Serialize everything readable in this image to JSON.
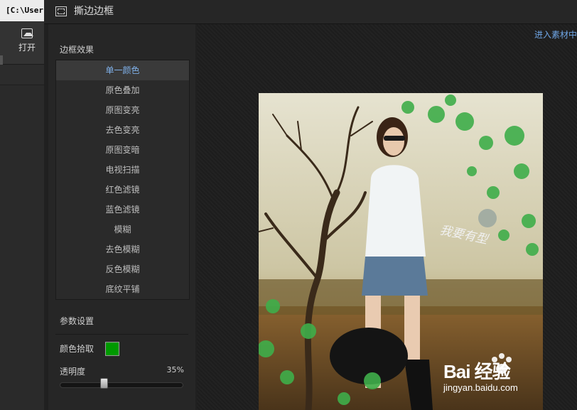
{
  "background_app": {
    "title_fragment": "[C:\\User",
    "open_label": "打开"
  },
  "dialog": {
    "title": "撕边边框",
    "enter_material_link": "进入素材中"
  },
  "border_effects": {
    "section_title": "边框效果",
    "selected_index": 0,
    "items": [
      {
        "label": "单一颜色"
      },
      {
        "label": "原色叠加"
      },
      {
        "label": "原图变亮"
      },
      {
        "label": "去色变亮"
      },
      {
        "label": "原图变暗"
      },
      {
        "label": "电视扫描"
      },
      {
        "label": "红色滤镜"
      },
      {
        "label": "蓝色滤镜"
      },
      {
        "label": "模糊"
      },
      {
        "label": "去色模糊"
      },
      {
        "label": "反色模糊"
      },
      {
        "label": "底纹平铺"
      }
    ]
  },
  "params": {
    "section_title": "参数设置",
    "color_pick_label": "颜色拾取",
    "color_value": "#009900",
    "opacity_label": "透明度",
    "opacity_text": "35%",
    "opacity_fraction": 0.35
  },
  "preview": {
    "photo_caption": "我要有型",
    "watermark_main": "Bai 经验",
    "watermark_sub": "jingyan.baidu.com"
  },
  "colors": {
    "accent_link": "#6fa6e6",
    "selected_item_text": "#7fb0e8",
    "flower_green": "#3fae4a"
  }
}
